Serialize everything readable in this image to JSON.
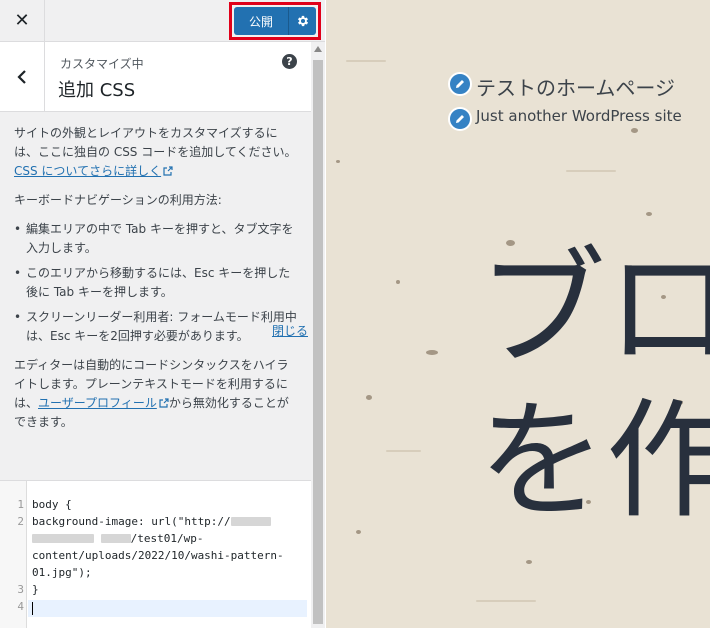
{
  "topbar": {
    "close_glyph": "✕",
    "publish_label": "公開",
    "gear_icon": "gear-icon"
  },
  "section": {
    "breadcrumb": "カスタマイズ中",
    "title": "追加 CSS",
    "help_glyph": "?"
  },
  "description": {
    "intro": "サイトの外観とレイアウトをカスタマイズするには、ここに独自の CSS コードを追加してください。",
    "learn_more_link": "CSS についてさらに詳しく",
    "keyboard_heading": "キーボードナビゲーションの利用方法:",
    "bullets": [
      "編集エリアの中で Tab キーを押すと、タブ文字を入力します。",
      "このエリアから移動するには、Esc キーを押した後に Tab キーを押します。",
      "スクリーンリーダー利用者: フォームモード利用中は、Esc キーを2回押す必要があります。"
    ],
    "editor_note_before": "エディターは自動的にコードシンタックスをハイライトします。プレーンテキストモードを利用するには、",
    "user_profile_link": "ユーザープロフィール",
    "editor_note_after": "から無効化することができます。",
    "close_link": "閉じる"
  },
  "code": {
    "line_numbers": [
      "1",
      "2",
      "3",
      "4"
    ],
    "line1": "body {",
    "line2a": "background-image: url(\"http://",
    "line2c": "/test01/wp-",
    "line2d": "content/uploads/2022/10/washi-pattern-",
    "line2e": "01.jpg\");",
    "line3": "}",
    "line4": ""
  },
  "preview": {
    "site_title": "テストのホームページ",
    "tagline": "Just another WordPress site",
    "hero_line1": "ブロ",
    "hero_line2": "を作"
  },
  "colors": {
    "accent": "#2271b1",
    "highlight_border": "#e0001a",
    "paper": "#e9e2d4",
    "heading": "#28303d"
  }
}
